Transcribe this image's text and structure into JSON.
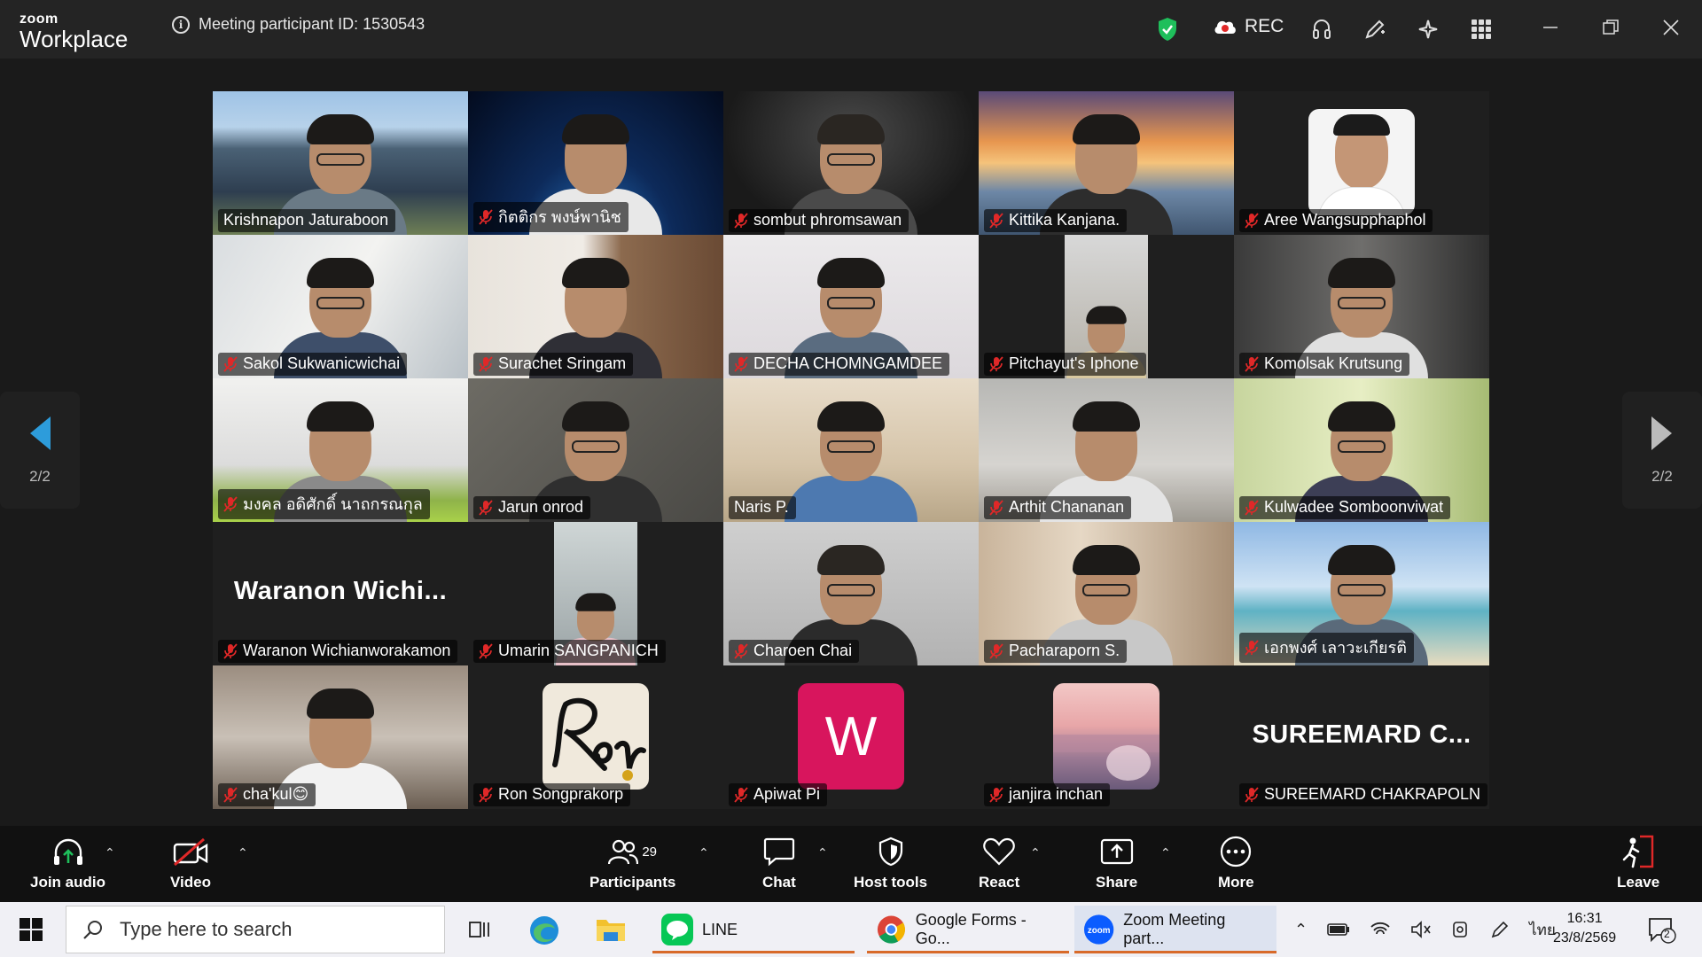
{
  "titlebar": {
    "logo_top": "zoom",
    "logo_bottom": "Workplace",
    "meeting_info": "Meeting participant ID: 1530543",
    "rec_label": "REC"
  },
  "gallery": {
    "page_left": "2/2",
    "page_right": "2/2",
    "participants": [
      {
        "name": "Krishnapon Jaturaboon",
        "muted": false,
        "bg": "solar"
      },
      {
        "name": "กิตติกร พงษ์พานิช",
        "muted": true,
        "bg": "space"
      },
      {
        "name": "sombut phromsawan",
        "muted": true,
        "bg": "dark"
      },
      {
        "name": "Kittika Kanjana.",
        "muted": true,
        "bg": "bridge"
      },
      {
        "name": "Aree Wangsupphaphol",
        "muted": true,
        "bg": "avatar-photo"
      },
      {
        "name": "Sakol Sukwanicwichai",
        "muted": true,
        "bg": "office"
      },
      {
        "name": "Surachet Sringam",
        "muted": true,
        "bg": "presentation"
      },
      {
        "name": "DECHA CHOMNGAMDEE",
        "muted": true,
        "bg": "white"
      },
      {
        "name": "Pitchayut's Iphone",
        "muted": true,
        "bg": "narrow"
      },
      {
        "name": "Komolsak Krutsung",
        "muted": true,
        "bg": "office2"
      },
      {
        "name": "มงคล อดิศักดิ์ นาถกรณกุล",
        "muted": true,
        "bg": "room"
      },
      {
        "name": "Jarun onrod",
        "muted": true,
        "bg": "gray"
      },
      {
        "name": "Naris P.",
        "muted": false,
        "bg": "arches"
      },
      {
        "name": "Arthit Chananan",
        "muted": true,
        "bg": "blurred"
      },
      {
        "name": "Kulwadee Somboonviwat",
        "muted": true,
        "bg": "green"
      },
      {
        "name": "Waranon Wichianworakamon",
        "muted": true,
        "bg": "text",
        "display_name": "Waranon  Wichi..."
      },
      {
        "name": "Umarin SANGPANICH",
        "muted": true,
        "bg": "narrow2"
      },
      {
        "name": "Charoen Chai",
        "muted": true,
        "bg": "gray2"
      },
      {
        "name": "Pacharaporn S.",
        "muted": true,
        "bg": "interior"
      },
      {
        "name": "เอกพงศ์ เลาวะเกียรติ",
        "muted": true,
        "bg": "beach"
      },
      {
        "name": "cha'kul😊",
        "muted": true,
        "bg": "mall"
      },
      {
        "name": "Ron Songprakorp",
        "muted": true,
        "bg": "signature"
      },
      {
        "name": "Apiwat Pi",
        "muted": true,
        "bg": "letter",
        "letter": "W"
      },
      {
        "name": "janjira inchan",
        "muted": true,
        "bg": "painting"
      },
      {
        "name": "SUREEMARD CHAKRAPOLN",
        "muted": true,
        "bg": "text",
        "display_name": "SUREEMARD  C..."
      }
    ]
  },
  "toolbar": {
    "join_audio": "Join audio",
    "video": "Video",
    "participants": "Participants",
    "participants_count": "29",
    "chat": "Chat",
    "host_tools": "Host tools",
    "react": "React",
    "share": "Share",
    "more": "More",
    "leave": "Leave"
  },
  "taskbar": {
    "search_placeholder": "Type here to search",
    "apps": [
      {
        "label": "LINE"
      },
      {
        "label": "Google Forms - Go..."
      },
      {
        "label": "Zoom Meeting part..."
      }
    ],
    "lang": "ไทย",
    "time": "16:31",
    "date": "23/8/2569",
    "notif_count": "2"
  },
  "colors": {
    "accent_blue": "#0b5cff",
    "shield_green": "#1fbf5b",
    "muted_red": "#e02828",
    "nav_arrow_blue": "#2d9cdb",
    "leave_red": "#e02828"
  }
}
